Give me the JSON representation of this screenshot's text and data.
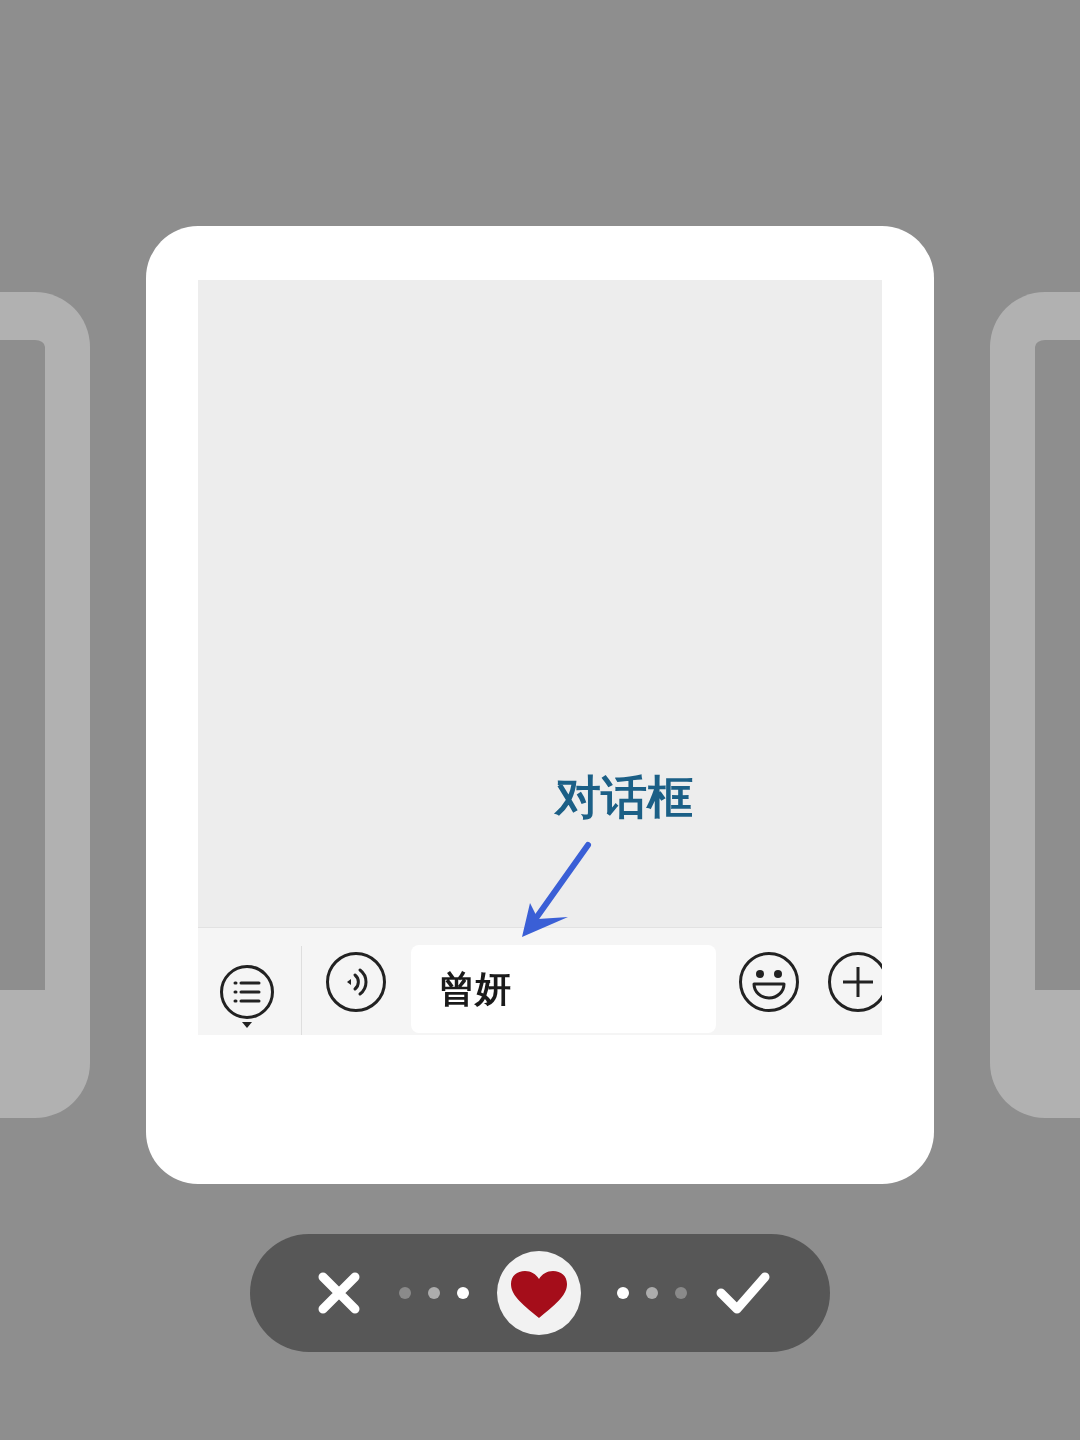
{
  "annotation": {
    "text": "对话框"
  },
  "chat_input": {
    "value": "曾妍"
  }
}
